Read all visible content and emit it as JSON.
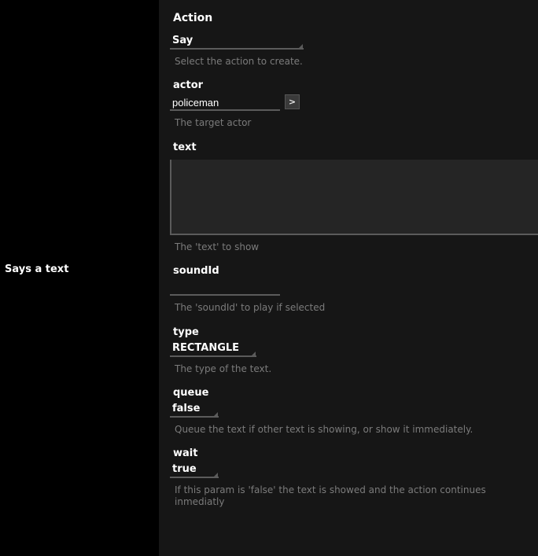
{
  "left": {
    "description": "Says a text"
  },
  "panel": {
    "title": "Action"
  },
  "fields": {
    "action": {
      "label": "Say",
      "value": "Say",
      "hint": "Select the action to create."
    },
    "actor": {
      "label": "actor",
      "value": "policeman",
      "browse": ">",
      "hint": "The target actor"
    },
    "text": {
      "label": "text",
      "value": "",
      "hint": "The 'text' to show"
    },
    "soundId": {
      "label": "soundId",
      "value": "",
      "hint": "The 'soundId' to play if selected"
    },
    "type": {
      "label": "type",
      "value": "RECTANGLE",
      "hint": "The type of the text."
    },
    "queue": {
      "label": "queue",
      "value": "false",
      "hint": "Queue the text if other text is showing, or show it immediately."
    },
    "wait": {
      "label": "wait",
      "value": "true",
      "hint": "If this param is 'false' the text is showed and the action continues inmediatly"
    }
  }
}
